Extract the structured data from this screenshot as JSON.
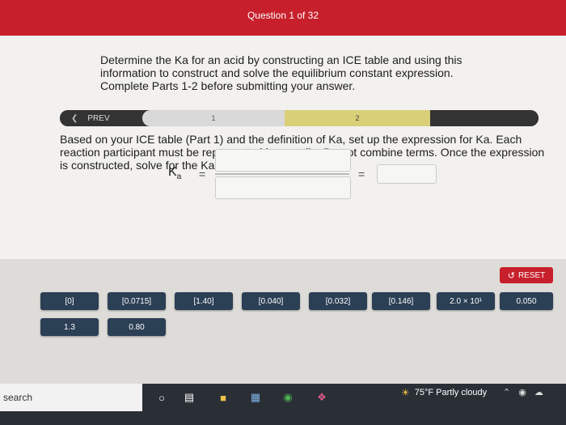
{
  "header": {
    "question_counter": "Question 1 of 32"
  },
  "intro_text": "Determine the Ka for an acid by constructing an ICE table and using this information to construct and solve the equilibrium constant expression. Complete Parts 1-2 before submitting your answer.",
  "progress": {
    "prev_label": "PREV",
    "steps": [
      {
        "label": "1"
      },
      {
        "label": "2"
      }
    ],
    "active_step": "2"
  },
  "instructions": "Based on your ICE table (Part 1) and the definition of Ka, set up the expression for Ka. Each reaction participant must be represented by one tile. Do not combine terms. Once the expression is constructed, solve for the Ka of CCl₃CO₂H.",
  "expression": {
    "ka_symbol": "K",
    "ka_subscript": "a",
    "equals": "=",
    "equals2": "="
  },
  "tiles": {
    "reset_label": "RESET",
    "row1": [
      "[0]",
      "[0.0715]",
      "[1.40]",
      "[0.040]",
      "[0.032]",
      "[0.146]",
      "2.0 × 10¹",
      "0.050"
    ],
    "row2": [
      "1.3",
      "0.80"
    ]
  },
  "taskbar": {
    "search_text": "search",
    "weather": "75°F  Partly cloudy"
  },
  "colors": {
    "accent_red": "#c7202c",
    "tile_navy": "#2b3f55",
    "progress_active": "#d9cf79"
  }
}
